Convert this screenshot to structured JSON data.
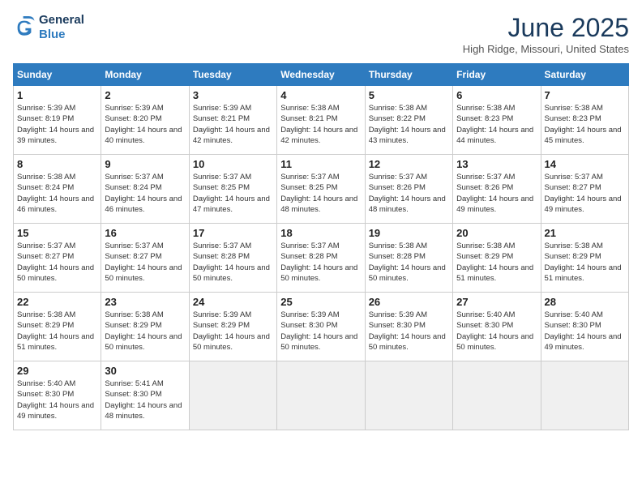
{
  "header": {
    "logo_line1": "General",
    "logo_line2": "Blue",
    "month": "June 2025",
    "location": "High Ridge, Missouri, United States"
  },
  "weekdays": [
    "Sunday",
    "Monday",
    "Tuesday",
    "Wednesday",
    "Thursday",
    "Friday",
    "Saturday"
  ],
  "weeks": [
    [
      {
        "day": "1",
        "sunrise": "5:39 AM",
        "sunset": "8:19 PM",
        "daylight": "14 hours and 39 minutes."
      },
      {
        "day": "2",
        "sunrise": "5:39 AM",
        "sunset": "8:20 PM",
        "daylight": "14 hours and 40 minutes."
      },
      {
        "day": "3",
        "sunrise": "5:39 AM",
        "sunset": "8:21 PM",
        "daylight": "14 hours and 42 minutes."
      },
      {
        "day": "4",
        "sunrise": "5:38 AM",
        "sunset": "8:21 PM",
        "daylight": "14 hours and 42 minutes."
      },
      {
        "day": "5",
        "sunrise": "5:38 AM",
        "sunset": "8:22 PM",
        "daylight": "14 hours and 43 minutes."
      },
      {
        "day": "6",
        "sunrise": "5:38 AM",
        "sunset": "8:23 PM",
        "daylight": "14 hours and 44 minutes."
      },
      {
        "day": "7",
        "sunrise": "5:38 AM",
        "sunset": "8:23 PM",
        "daylight": "14 hours and 45 minutes."
      }
    ],
    [
      {
        "day": "8",
        "sunrise": "5:38 AM",
        "sunset": "8:24 PM",
        "daylight": "14 hours and 46 minutes."
      },
      {
        "day": "9",
        "sunrise": "5:37 AM",
        "sunset": "8:24 PM",
        "daylight": "14 hours and 46 minutes."
      },
      {
        "day": "10",
        "sunrise": "5:37 AM",
        "sunset": "8:25 PM",
        "daylight": "14 hours and 47 minutes."
      },
      {
        "day": "11",
        "sunrise": "5:37 AM",
        "sunset": "8:25 PM",
        "daylight": "14 hours and 48 minutes."
      },
      {
        "day": "12",
        "sunrise": "5:37 AM",
        "sunset": "8:26 PM",
        "daylight": "14 hours and 48 minutes."
      },
      {
        "day": "13",
        "sunrise": "5:37 AM",
        "sunset": "8:26 PM",
        "daylight": "14 hours and 49 minutes."
      },
      {
        "day": "14",
        "sunrise": "5:37 AM",
        "sunset": "8:27 PM",
        "daylight": "14 hours and 49 minutes."
      }
    ],
    [
      {
        "day": "15",
        "sunrise": "5:37 AM",
        "sunset": "8:27 PM",
        "daylight": "14 hours and 50 minutes."
      },
      {
        "day": "16",
        "sunrise": "5:37 AM",
        "sunset": "8:27 PM",
        "daylight": "14 hours and 50 minutes."
      },
      {
        "day": "17",
        "sunrise": "5:37 AM",
        "sunset": "8:28 PM",
        "daylight": "14 hours and 50 minutes."
      },
      {
        "day": "18",
        "sunrise": "5:37 AM",
        "sunset": "8:28 PM",
        "daylight": "14 hours and 50 minutes."
      },
      {
        "day": "19",
        "sunrise": "5:38 AM",
        "sunset": "8:28 PM",
        "daylight": "14 hours and 50 minutes."
      },
      {
        "day": "20",
        "sunrise": "5:38 AM",
        "sunset": "8:29 PM",
        "daylight": "14 hours and 51 minutes."
      },
      {
        "day": "21",
        "sunrise": "5:38 AM",
        "sunset": "8:29 PM",
        "daylight": "14 hours and 51 minutes."
      }
    ],
    [
      {
        "day": "22",
        "sunrise": "5:38 AM",
        "sunset": "8:29 PM",
        "daylight": "14 hours and 51 minutes."
      },
      {
        "day": "23",
        "sunrise": "5:38 AM",
        "sunset": "8:29 PM",
        "daylight": "14 hours and 50 minutes."
      },
      {
        "day": "24",
        "sunrise": "5:39 AM",
        "sunset": "8:29 PM",
        "daylight": "14 hours and 50 minutes."
      },
      {
        "day": "25",
        "sunrise": "5:39 AM",
        "sunset": "8:30 PM",
        "daylight": "14 hours and 50 minutes."
      },
      {
        "day": "26",
        "sunrise": "5:39 AM",
        "sunset": "8:30 PM",
        "daylight": "14 hours and 50 minutes."
      },
      {
        "day": "27",
        "sunrise": "5:40 AM",
        "sunset": "8:30 PM",
        "daylight": "14 hours and 50 minutes."
      },
      {
        "day": "28",
        "sunrise": "5:40 AM",
        "sunset": "8:30 PM",
        "daylight": "14 hours and 49 minutes."
      }
    ],
    [
      {
        "day": "29",
        "sunrise": "5:40 AM",
        "sunset": "8:30 PM",
        "daylight": "14 hours and 49 minutes."
      },
      {
        "day": "30",
        "sunrise": "5:41 AM",
        "sunset": "8:30 PM",
        "daylight": "14 hours and 48 minutes."
      },
      null,
      null,
      null,
      null,
      null
    ]
  ]
}
